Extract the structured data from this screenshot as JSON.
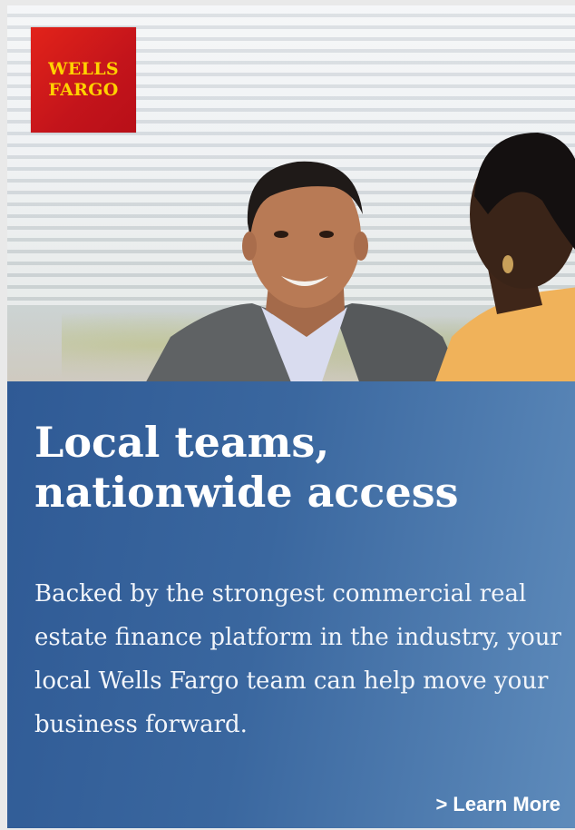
{
  "brand": {
    "line1": "WELLS",
    "line2": "FARGO",
    "colors": {
      "red": "#d71e28",
      "gold": "#ffd200"
    }
  },
  "photo": {
    "icon": "photo-two-people-talking"
  },
  "copy": {
    "headline": "Local teams, nationwide access",
    "body": "Backed by the strongest commercial real estate finance platform in the industry, your local Wells Fargo team can help move your business forward.",
    "background_color": "#3a679f"
  },
  "cta": {
    "label": "> Learn More"
  }
}
